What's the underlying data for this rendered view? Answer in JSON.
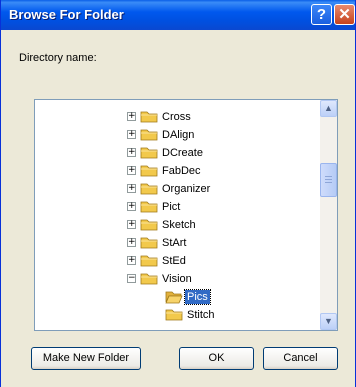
{
  "window": {
    "title": "Browse For Folder",
    "help_glyph": "?",
    "close_glyph": "✕"
  },
  "directory_label": "Directory name:",
  "tree": {
    "items": [
      {
        "label": "Cross",
        "expander": "+",
        "level": 0
      },
      {
        "label": "DAlign",
        "expander": "+",
        "level": 0
      },
      {
        "label": "DCreate",
        "expander": "+",
        "level": 0
      },
      {
        "label": "FabDec",
        "expander": "+",
        "level": 0
      },
      {
        "label": "Organizer",
        "expander": "+",
        "level": 0
      },
      {
        "label": "Pict",
        "expander": "+",
        "level": 0
      },
      {
        "label": "Sketch",
        "expander": "+",
        "level": 0
      },
      {
        "label": "StArt",
        "expander": "+",
        "level": 0
      },
      {
        "label": "StEd",
        "expander": "+",
        "level": 0
      },
      {
        "label": "Vision",
        "expander": "−",
        "level": 0
      },
      {
        "label": "Pics",
        "expander": "",
        "level": 1,
        "selected": true,
        "open": true
      },
      {
        "label": "Stitch",
        "expander": "",
        "level": 1
      }
    ]
  },
  "buttons": {
    "new_folder": "Make New Folder",
    "ok": "OK",
    "cancel": "Cancel"
  },
  "colors": {
    "title_bar": "#0058ee",
    "selection": "#316ac5",
    "folder": "#f2c94c"
  }
}
